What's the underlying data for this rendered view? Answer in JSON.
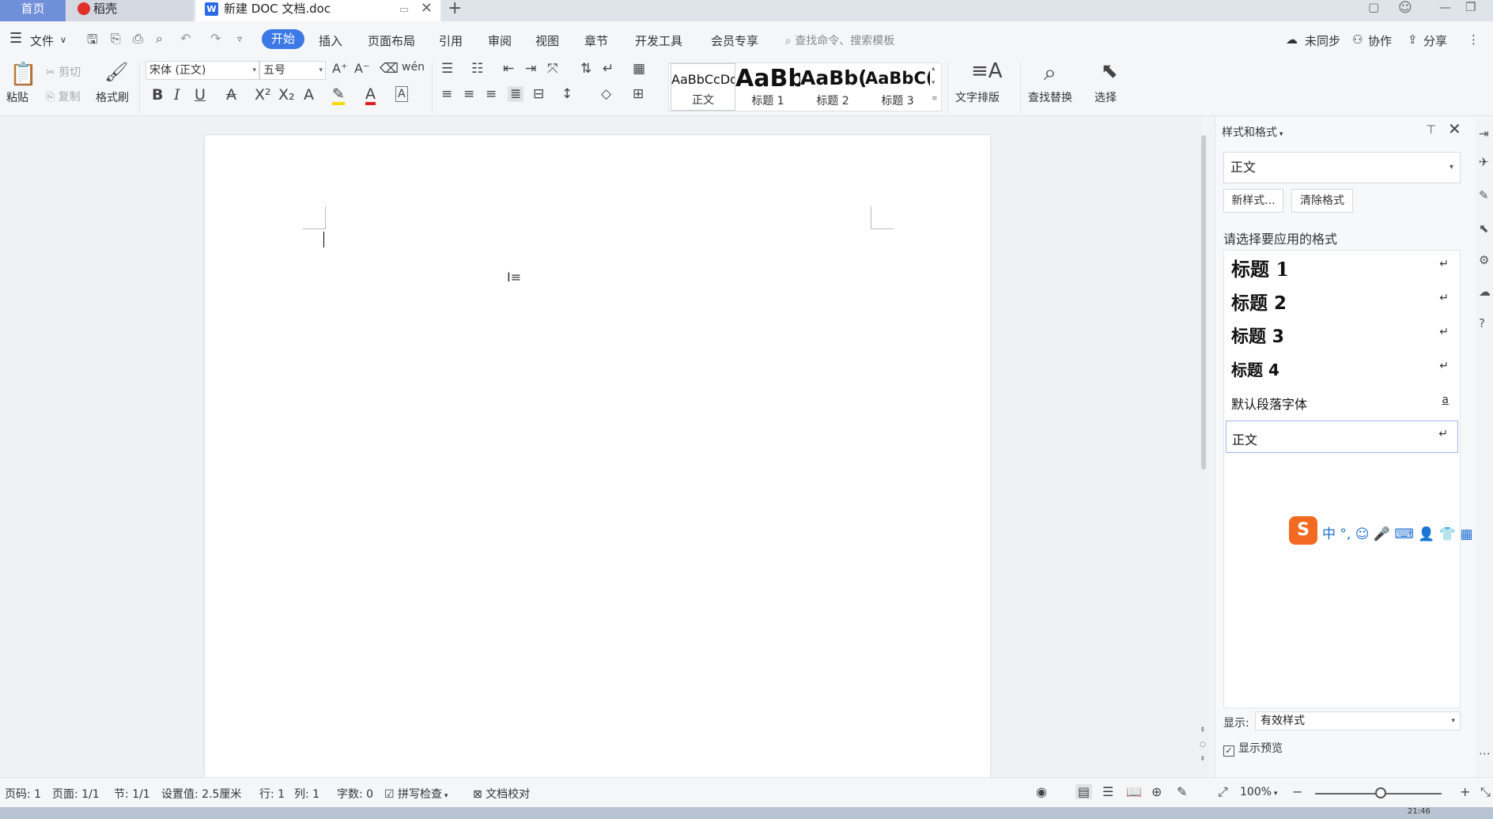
{
  "tabs": {
    "home": "首页",
    "daoke": "稻壳",
    "document": "新建 DOC 文档.doc",
    "new_tab": "+"
  },
  "menubar": {
    "file": "文件",
    "items": [
      "开始",
      "插入",
      "页面布局",
      "引用",
      "审阅",
      "视图",
      "章节",
      "开发工具",
      "会员专享"
    ],
    "active": "开始",
    "search_placeholder": "查找命令、搜索模板",
    "sync": "未同步",
    "collaborate": "协作",
    "share": "分享"
  },
  "ribbon": {
    "paste": "粘贴",
    "cut": "剪切",
    "copy": "复制",
    "format_painter": "格式刷",
    "font_name": "宋体 (正文)",
    "font_size": "五号",
    "styles": [
      {
        "preview": "AaBbCcDd",
        "label": "正文"
      },
      {
        "preview": "AaBb",
        "label": "标题 1"
      },
      {
        "preview": "AaBb(",
        "label": "标题 2"
      },
      {
        "preview": "AaBbC(",
        "label": "标题 3"
      }
    ],
    "text_layout": "文字排版",
    "find_replace": "查找替换",
    "select": "选择"
  },
  "panel": {
    "title": "样式和格式",
    "current_style": "正文",
    "new_style": "新样式...",
    "clear_format": "清除格式",
    "prompt": "请选择要应用的格式",
    "items": [
      {
        "name": "标题  1",
        "mark": "↵"
      },
      {
        "name": "标题  2",
        "mark": "↵"
      },
      {
        "name": "标题  3",
        "mark": "↵"
      },
      {
        "name": "标题  4",
        "mark": "↵"
      },
      {
        "name": "默认段落字体",
        "mark": "a"
      },
      {
        "name": "正文",
        "mark": "↵"
      }
    ],
    "show_label": "显示:",
    "show_value": "有效样式",
    "show_preview": "显示预览",
    "ime_text": "中 °, ☺ 🎤 ⌨ 👤 👕 ▦"
  },
  "statusbar": {
    "page_no": "页码: 1",
    "pages": "页面: 1/1",
    "section": "节: 1/1",
    "setting": "设置值: 2.5厘米",
    "row": "行: 1",
    "col": "列: 1",
    "word_count": "字数: 0",
    "spell_check": "拼写检查",
    "proofread": "文档校对",
    "zoom": "100%"
  },
  "taskbar": {
    "clock": "21:46"
  },
  "colors": {
    "accent": "#3c78e6",
    "home_tab": "#6f8fd9",
    "ime_logo": "#f26a21"
  }
}
